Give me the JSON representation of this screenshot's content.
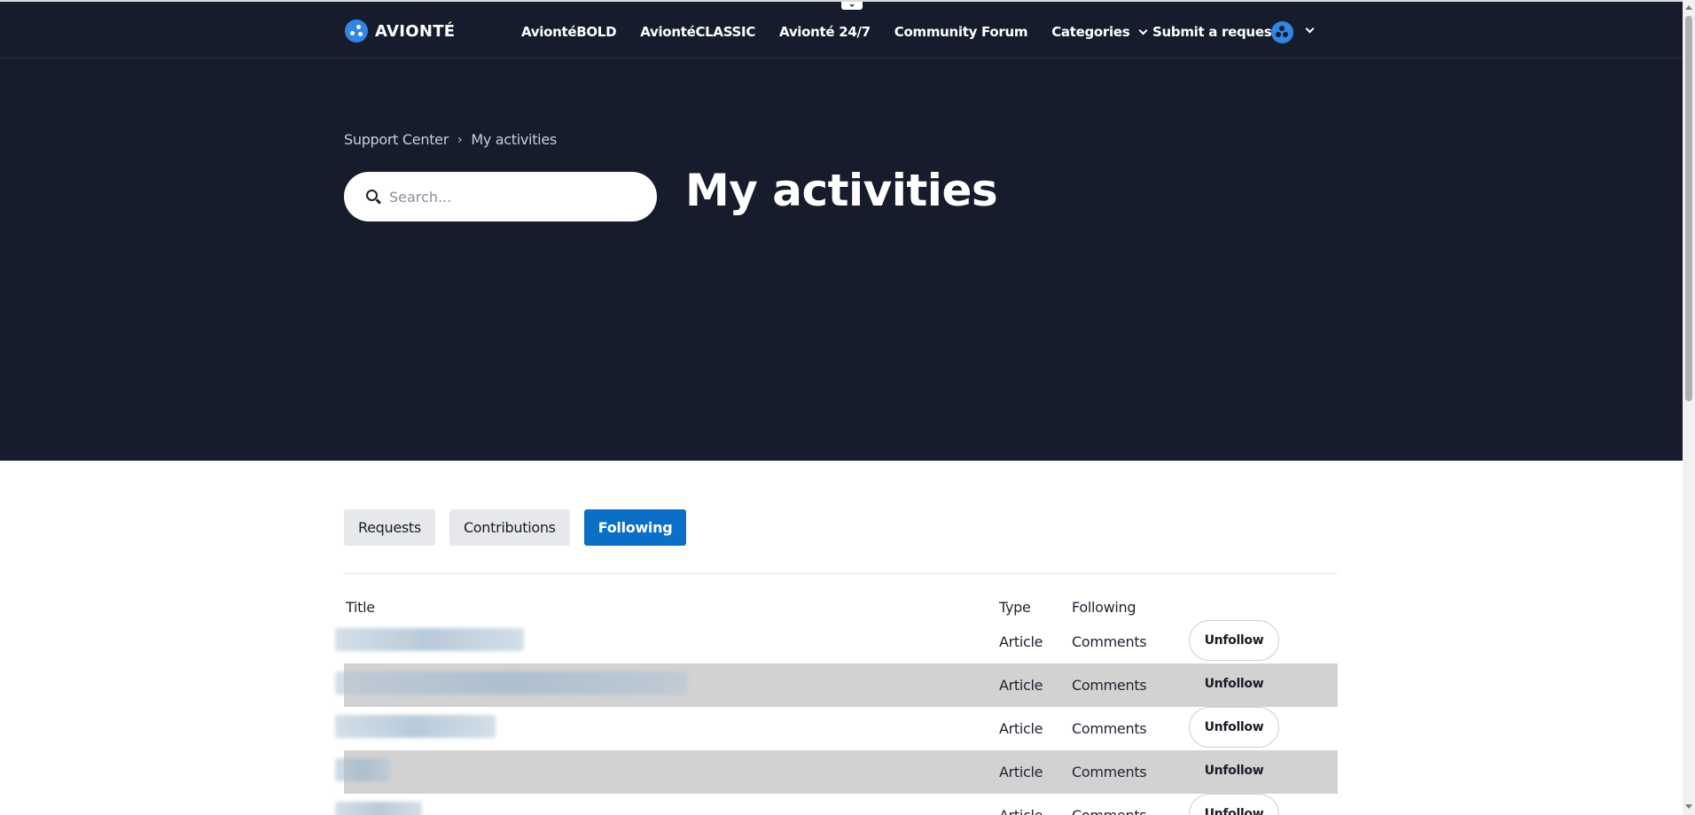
{
  "header": {
    "logo_text": "AVIONTÉ",
    "nav": [
      {
        "label": "AviontéBOLD"
      },
      {
        "label": "AviontéCLASSIC"
      },
      {
        "label": "Avionté 24/7"
      },
      {
        "label": "Community Forum"
      },
      {
        "label": "Categories"
      }
    ],
    "submit_request": "Submit a request"
  },
  "hero": {
    "breadcrumb": [
      "Support Center",
      "My activities"
    ],
    "breadcrumb_separator": "›",
    "search_placeholder": "Search...",
    "title": "My activities",
    "background_color": "#161c2c"
  },
  "tabs": [
    {
      "label": "Requests",
      "active": false
    },
    {
      "label": "Contributions",
      "active": false
    },
    {
      "label": "Following",
      "active": true
    }
  ],
  "accent_color": "#0b6fc7",
  "table": {
    "headers": {
      "title": "Title",
      "type": "Type",
      "following": "Following"
    },
    "rows": [
      {
        "type": "Article",
        "following": "Comments",
        "action": "Unfollow",
        "title_redacted": true
      },
      {
        "type": "Article",
        "following": "Comments",
        "action": "Unfollow",
        "title_redacted": true
      },
      {
        "type": "Article",
        "following": "Comments",
        "action": "Unfollow",
        "title_redacted": true
      },
      {
        "type": "Article",
        "following": "Comments",
        "action": "Unfollow",
        "title_redacted": true
      },
      {
        "type": "Article",
        "following": "Comments",
        "action": "Unfollow",
        "title_redacted": true
      }
    ]
  }
}
